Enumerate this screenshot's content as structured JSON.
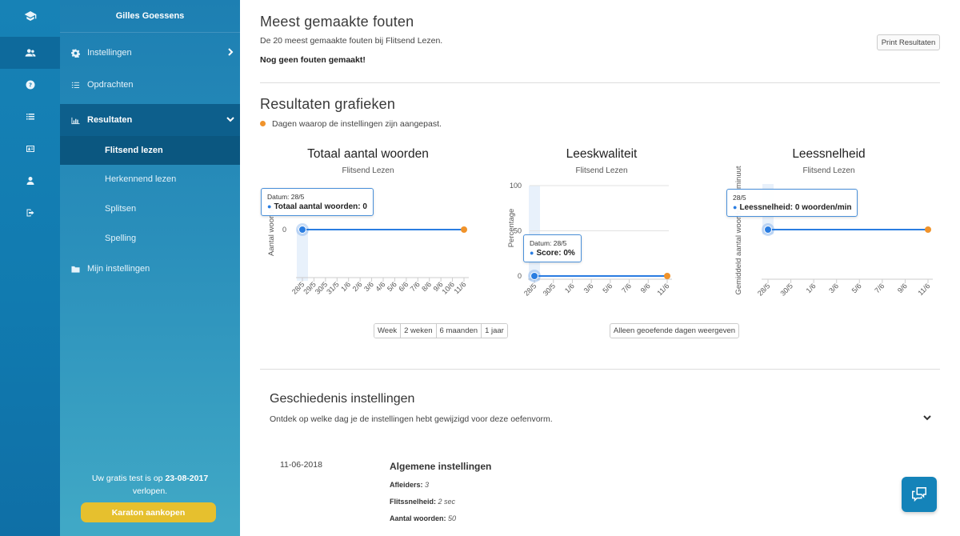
{
  "sidebar": {
    "user_name": "Gilles Goessens",
    "items": [
      {
        "label": "Instellingen",
        "icon": "gear-icon"
      },
      {
        "label": "Opdrachten",
        "icon": "list-icon"
      },
      {
        "label": "Resultaten",
        "icon": "bar-chart-icon"
      },
      {
        "label": "Mijn instellingen",
        "icon": "folder-icon"
      }
    ],
    "subitems": [
      "Flitsend lezen",
      "Herkennend lezen",
      "Splitsen",
      "Spelling"
    ],
    "trial_prefix": "Uw gratis test is op",
    "trial_date": "23-08-2017",
    "trial_suffix": "verlopen.",
    "buy_label": "Karaton aankopen"
  },
  "rail": {
    "icons": [
      "graduation-cap-icon",
      "users-icon",
      "question-icon",
      "list-icon",
      "id-card-icon",
      "user-icon",
      "sign-out-icon"
    ]
  },
  "errors": {
    "title": "Meest gemaakte fouten",
    "description": "De 20 meest gemaakte fouten bij Flitsend Lezen.",
    "empty": "Nog geen fouten gemaakt!",
    "print_label": "Print Resultaten"
  },
  "graphs": {
    "title": "Resultaten grafieken",
    "legend": "Dagen waarop de instellingen zijn aangepast.",
    "range_buttons": [
      "Week",
      "2 weken",
      "6 maanden",
      "1 jaar"
    ],
    "practiced_days_label": "Alleen geoefende dagen weergeven"
  },
  "chart_data": [
    {
      "type": "line",
      "title": "Totaal aantal woorden",
      "subtitle": "Flitsend Lezen",
      "ylabel": "Aantal woorden",
      "yticks": [
        "0"
      ],
      "categories": [
        "28/5",
        "29/5",
        "30/5",
        "31/5",
        "1/6",
        "2/6",
        "3/6",
        "4/6",
        "5/6",
        "6/6",
        "7/6",
        "8/6",
        "9/6",
        "10/6",
        "11/6"
      ],
      "series": [
        {
          "values": [
            0,
            0,
            0,
            0,
            0,
            0,
            0,
            0,
            0,
            0,
            0,
            0,
            0,
            0,
            0
          ]
        }
      ],
      "settings_changed": [
        "11/6"
      ],
      "tooltip": {
        "date": "Datum: 28/5",
        "label": "Totaal aantal woorden: 0"
      }
    },
    {
      "type": "line",
      "title": "Leeskwaliteit",
      "subtitle": "Flitsend Lezen",
      "ylabel": "Percentage",
      "yticks": [
        "100",
        "50",
        "0"
      ],
      "ylim": [
        0,
        100
      ],
      "categories": [
        "28/5",
        "30/5",
        "1/6",
        "3/6",
        "5/6",
        "7/6",
        "9/6",
        "11/6"
      ],
      "series": [
        {
          "values": [
            0,
            0,
            0,
            0,
            0,
            0,
            0,
            0
          ]
        }
      ],
      "settings_changed": [
        "11/6"
      ],
      "tooltip": {
        "date": "Datum: 28/5",
        "label": "Score: 0%"
      }
    },
    {
      "type": "line",
      "title": "Leessnelheid",
      "subtitle": "Flitsend Lezen",
      "ylabel": "Gemiddeld aantal woorden per minuut",
      "yticks": [],
      "categories": [
        "28/5",
        "30/5",
        "1/6",
        "3/6",
        "5/6",
        "7/6",
        "9/6",
        "11/6"
      ],
      "series": [
        {
          "values": [
            0,
            0,
            0,
            0,
            0,
            0,
            0,
            0
          ]
        }
      ],
      "settings_changed": [
        "11/6"
      ],
      "tooltip": {
        "date": "28/5",
        "label": "Leessnelheid: 0 woorden/min"
      }
    }
  ],
  "history": {
    "title": "Geschiedenis instellingen",
    "description": "Ontdek op welke dag je de instellingen hebt gewijzigd voor deze oefenvorm.",
    "date": "11-06-2018",
    "heading": "Algemene instellingen",
    "rows": [
      {
        "label": "Afleiders:",
        "value": "3"
      },
      {
        "label": "Flitssnelheid:",
        "value": "2 sec"
      },
      {
        "label": "Aantal woorden:",
        "value": "50"
      }
    ]
  },
  "colors": {
    "accent": "#2a7de1",
    "settings_marker": "#f0932b",
    "sidebar_active": "#0d5f8c",
    "buy_button": "#e6c02e"
  }
}
